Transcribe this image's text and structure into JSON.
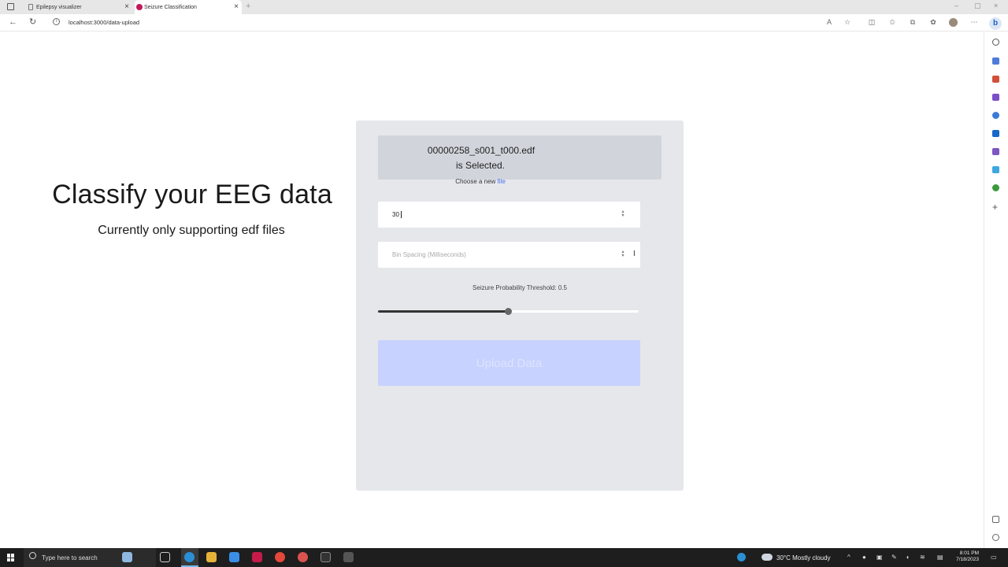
{
  "browser": {
    "tabs": [
      {
        "title": "Epilepsy visualizer",
        "active": false
      },
      {
        "title": "Seizure Classification",
        "active": true
      }
    ],
    "url": "localhost:3000/data-upload"
  },
  "page": {
    "title": "Classify your EEG data",
    "subtitle": "Currently only supporting edf files"
  },
  "form": {
    "file_name": "00000258_s001_t000.edf",
    "file_selected_text": "is Selected.",
    "choose_prefix": "Choose a new",
    "choose_link": "file",
    "first_input_value": "30",
    "bin_spacing_placeholder": "Bin Spacing (Milliseconds)",
    "threshold_label": "Seizure Probability Threshold: 0.5",
    "threshold_value": 0.5,
    "upload_label": "Upload Data"
  },
  "taskbar": {
    "search_placeholder": "Type here to search",
    "weather": "30°C  Mostly cloudy",
    "time": "8:01 PM",
    "date": "7/18/2023"
  },
  "colors": {
    "panel_bg": "#e5e7eb",
    "file_box_bg": "#d1d5db",
    "upload_button_bg": "#c7d2fe",
    "link": "#4f6ef7"
  }
}
